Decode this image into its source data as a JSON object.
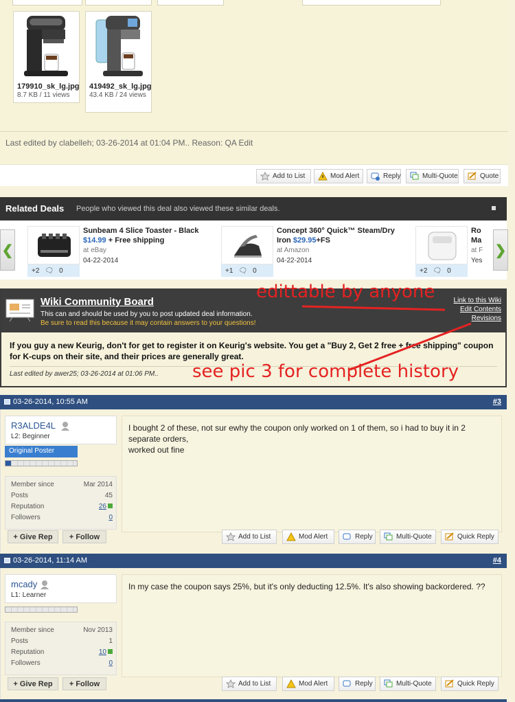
{
  "attachments": [
    {
      "name": "179910_sk_lg.jpg",
      "size": "8.7 KB / 11 views"
    },
    {
      "name": "419492_sk_lg.jpg",
      "size": "43.4 KB / 24 views"
    }
  ],
  "edit_note": "Last edited by clabelleh; 03-26-2014 at 01:04 PM.. Reason: QA Edit",
  "post_buttons": [
    "Add to List",
    "Mod Alert",
    "Reply",
    "Multi-Quote",
    "Quote"
  ],
  "related": {
    "title": "Related Deals",
    "subtitle": "People who viewed this deal also viewed these similar deals.",
    "prev_glyph": "❮",
    "next_glyph": "❯",
    "deals": [
      {
        "title": "Sunbeam 4 Slice Toaster - Black",
        "price": "$14.99",
        "extra": " + Free shipping",
        "source": "at eBay",
        "date": "04-22-2014",
        "votes": "+2",
        "comments": "0"
      },
      {
        "title": "Concept 360° Quick™ Steam/Dry Iron",
        "price": "$29.95",
        "extra": "+FS",
        "source": "at Amazon",
        "date": "04-22-2014",
        "votes": "+1",
        "comments": "0"
      },
      {
        "title": "Ro Ma",
        "price": "",
        "extra": "",
        "source": "at F",
        "date": "Yes",
        "votes": "+2",
        "comments": "0"
      }
    ]
  },
  "wiki": {
    "title": "Wiki Community Board",
    "desc": "This can and should be used by you to post updated deal information.",
    "warn": "Be sure to read this because it may contain answers to your questions!",
    "links": [
      "Link to this Wiki",
      "Edit Contents",
      "Revisions"
    ],
    "text": "If you guy a new Keurig, don't for get to register it on Keurig's website. You get a \"Buy 2, Get 2 free + free shipping\" coupon for K-cups on their site, and their prices are generally great.",
    "last_edited": "Last edited by awer25; 03-26-2014 at 01:06 PM..",
    "annotation_1": "edittable by anyone",
    "annotation_2": "see pic 3 for complete history"
  },
  "posts": [
    {
      "date": "03-26-2014, 10:55 AM",
      "num": "#3",
      "user": "R3ALDE4L",
      "rank": "L2: Beginner",
      "badge": "Original Poster",
      "member_since": "Mar 2014",
      "posts": "45",
      "reputation": "26",
      "followers": "0",
      "message_1": "I bought 2 of these, not sur ewhy the coupon only worked on 1 of them, so i had to buy it in 2 separate orders,",
      "message_2": "worked out fine"
    },
    {
      "date": "03-26-2014, 11:14 AM",
      "num": "#4",
      "user": "mcady",
      "rank": "L1: Learner",
      "badge": "",
      "member_since": "Nov 2013",
      "posts": "1",
      "reputation": "10",
      "followers": "0",
      "message_1": "In my case the coupon says 25%, but it's only deducting 12.5%. It's also showing backordered. ??",
      "message_2": ""
    }
  ],
  "stat_labels": {
    "member_since": "Member since",
    "posts": "Posts",
    "reputation": "Reputation",
    "followers": "Followers"
  },
  "user_buttons": {
    "give_rep": "+ Give Rep",
    "follow": "+ Follow"
  },
  "post_actions": [
    "Add to List",
    "Mod Alert",
    "Reply",
    "Multi-Quote",
    "Quick Reply"
  ]
}
